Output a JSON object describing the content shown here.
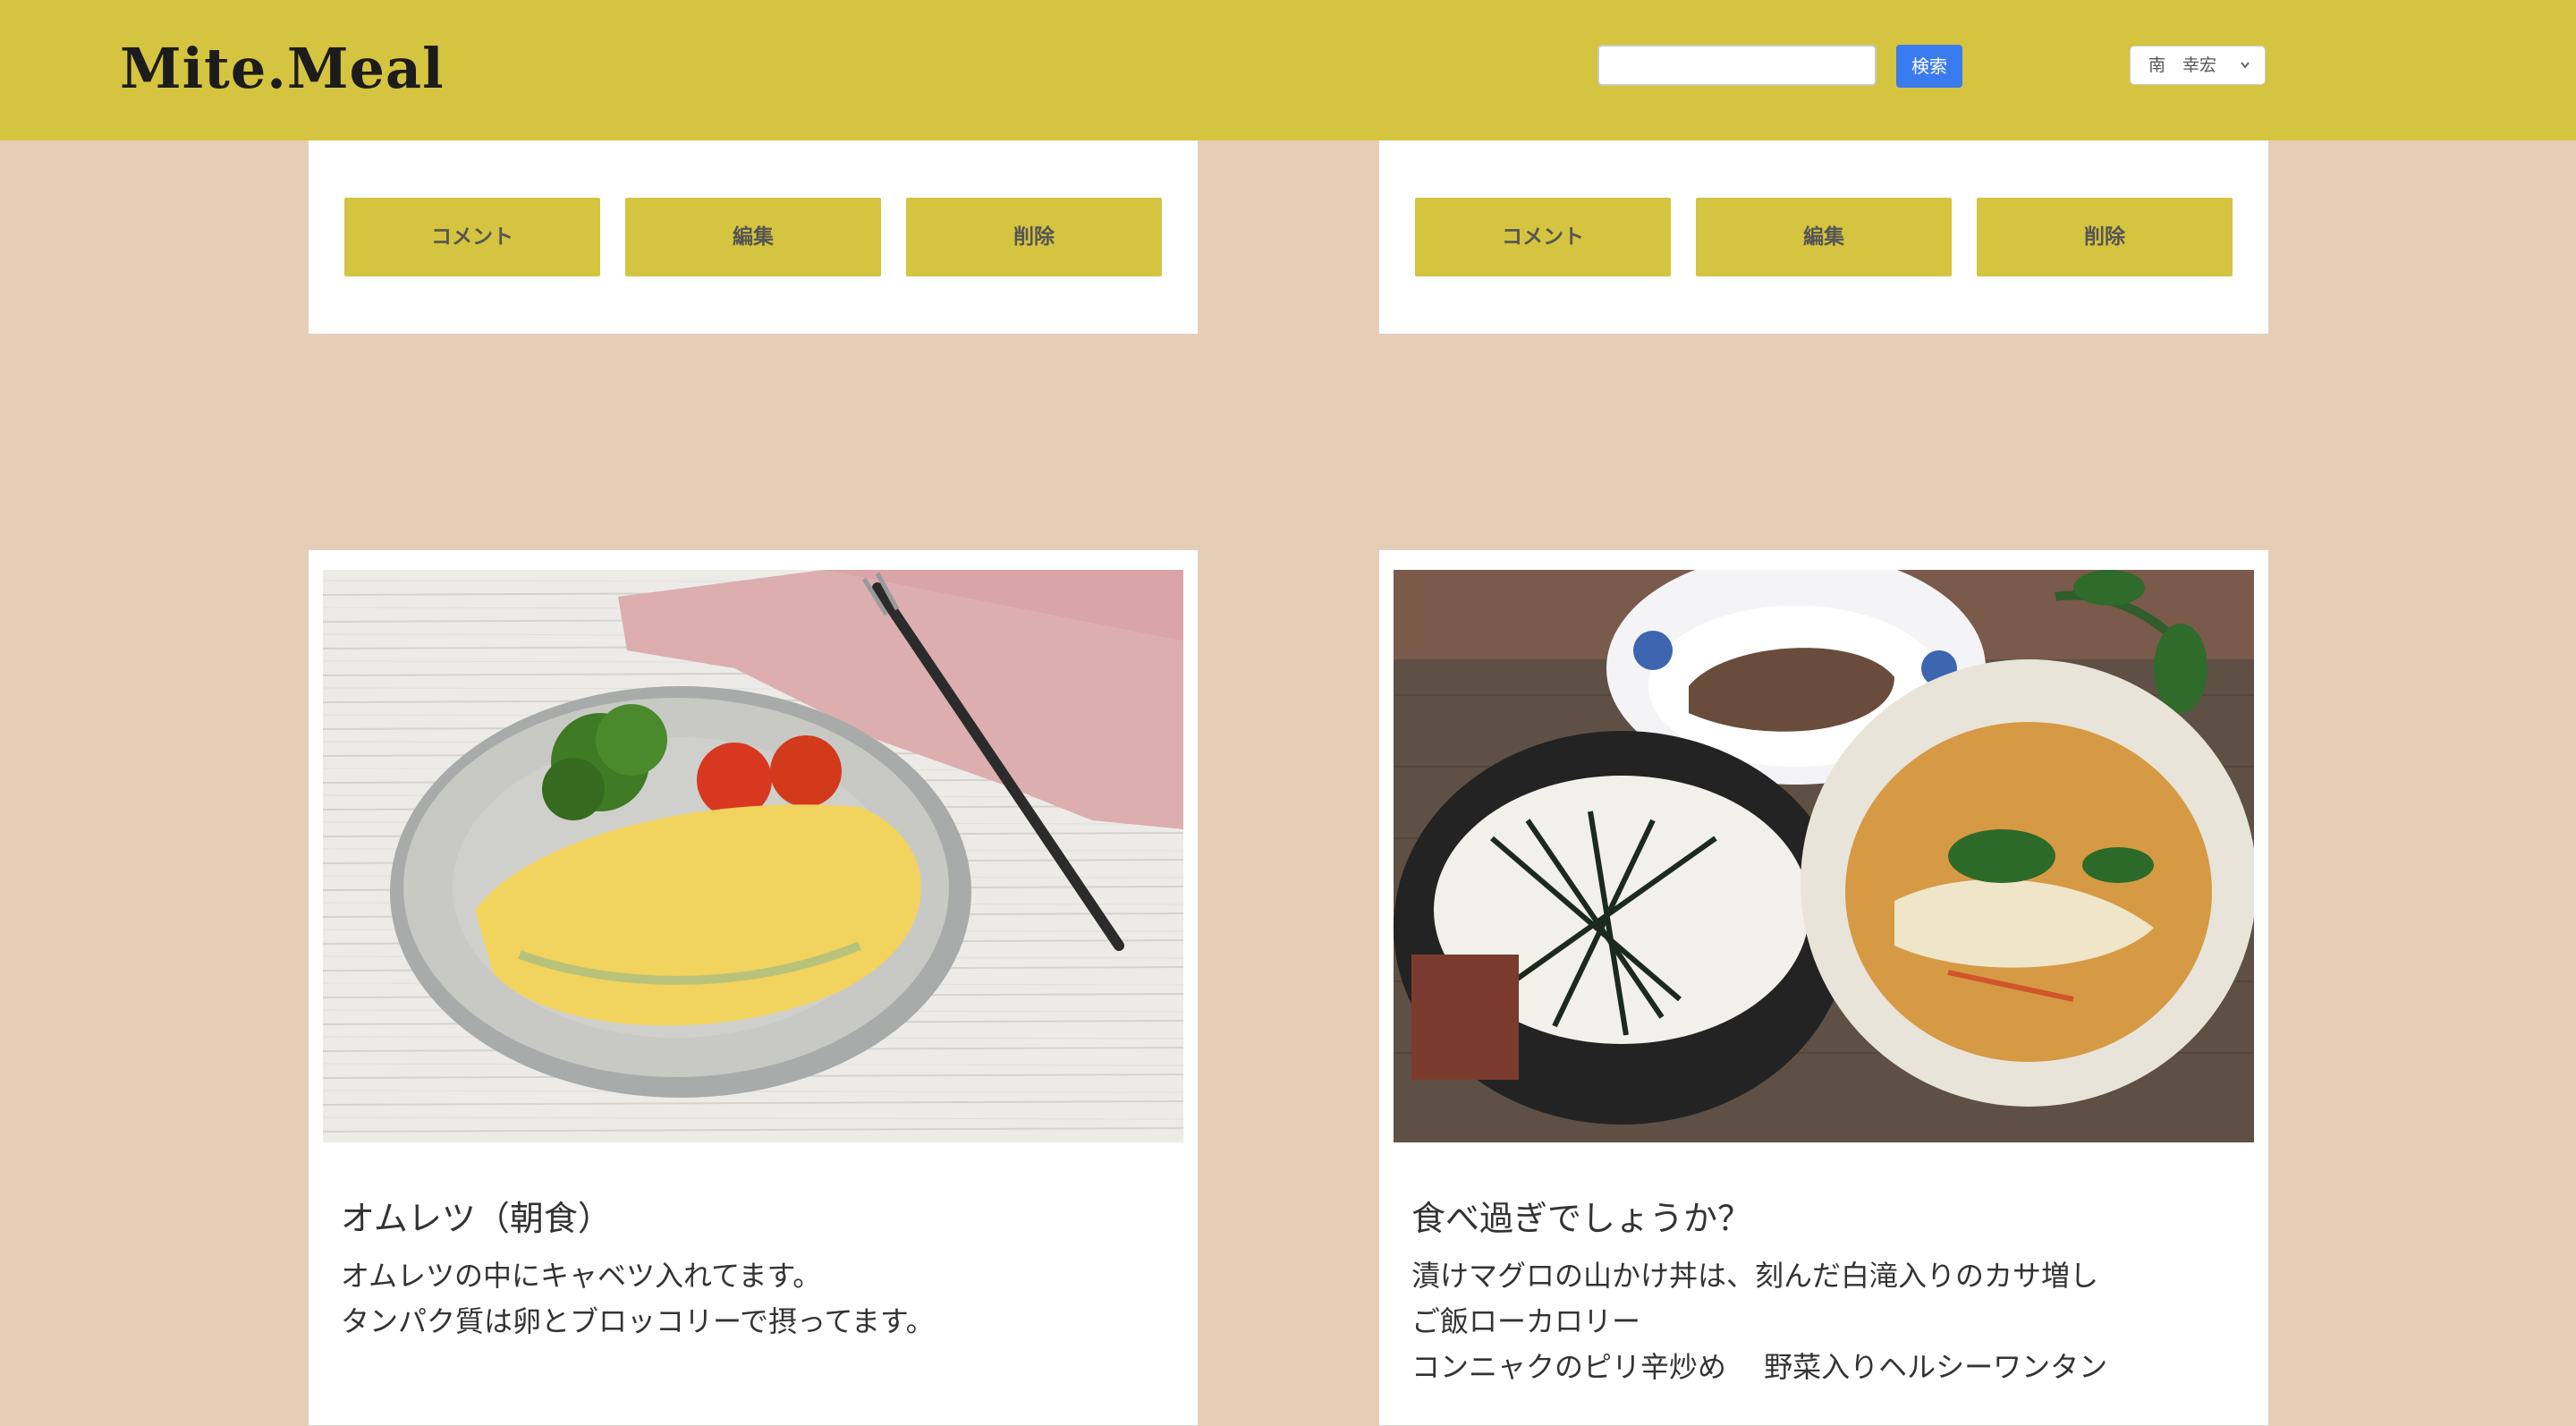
{
  "header": {
    "logo": "Mite.Meal",
    "search_placeholder": "",
    "search_button": "検索",
    "user_name": "南　幸宏",
    "user_menu_icon": "chevron-down-icon"
  },
  "top_cards": [
    {
      "comment": "コメント",
      "edit": "編集",
      "delete": "削除"
    },
    {
      "comment": "コメント",
      "edit": "編集",
      "delete": "削除"
    }
  ],
  "posts": [
    {
      "title": "オムレツ（朝食）",
      "description": "オムレツの中にキャベツ入れてます。\nタンパク質は卵とブロッコリーで摂ってます。"
    },
    {
      "title": "食べ過ぎでしょうか？",
      "description": "漬けマグロの山かけ丼は、刻んだ白滝入りのカサ増し\nご飯ローカロリー\nコンニャクのピリ辛炒め　 野菜入りヘルシーワンタン"
    }
  ],
  "colors": {
    "header_bg": "#d4c440",
    "page_bg": "#e6cdb5",
    "button_bg": "#d4c440",
    "search_button_bg": "#3b7bf0"
  }
}
